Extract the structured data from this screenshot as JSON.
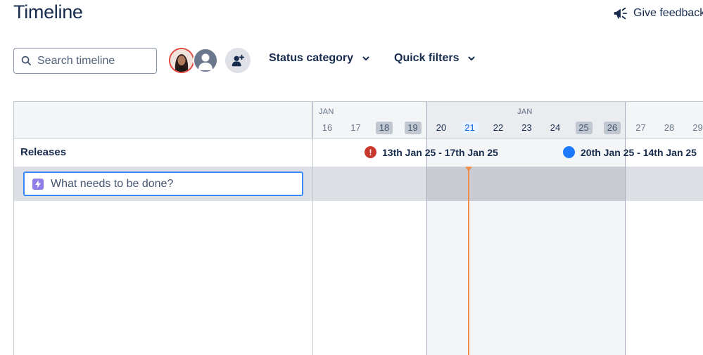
{
  "header": {
    "title": "Timeline",
    "feedback_label": "Give feedback"
  },
  "toolbar": {
    "search_placeholder": "Search timeline",
    "filters": [
      {
        "label": "Status category"
      },
      {
        "label": "Quick filters"
      }
    ]
  },
  "timeline": {
    "months": [
      "JAN",
      "JAN"
    ],
    "days": [
      {
        "label": "16",
        "state": "normal"
      },
      {
        "label": "17",
        "state": "normal"
      },
      {
        "label": "18",
        "state": "weekend"
      },
      {
        "label": "19",
        "state": "weekend"
      },
      {
        "label": "20",
        "state": "active"
      },
      {
        "label": "21",
        "state": "today"
      },
      {
        "label": "22",
        "state": "active"
      },
      {
        "label": "23",
        "state": "active"
      },
      {
        "label": "24",
        "state": "active"
      },
      {
        "label": "25",
        "state": "weekend"
      },
      {
        "label": "26",
        "state": "weekend"
      },
      {
        "label": "27",
        "state": "normal"
      },
      {
        "label": "28",
        "state": "normal"
      },
      {
        "label": "29",
        "state": "normal"
      }
    ],
    "releases_label": "Releases",
    "releases": [
      {
        "label": "13th Jan 25 - 17th Jan 25",
        "status": "overdue",
        "icon": "error-icon",
        "color": "#c9372c"
      },
      {
        "label": "20th Jan 25 - 14th Jan 25",
        "status": "unreleased",
        "icon": "release-dot-icon",
        "color": "#1d7afc"
      }
    ],
    "create_placeholder": "What needs to be done?",
    "today_line_color": "#f18d4b"
  }
}
